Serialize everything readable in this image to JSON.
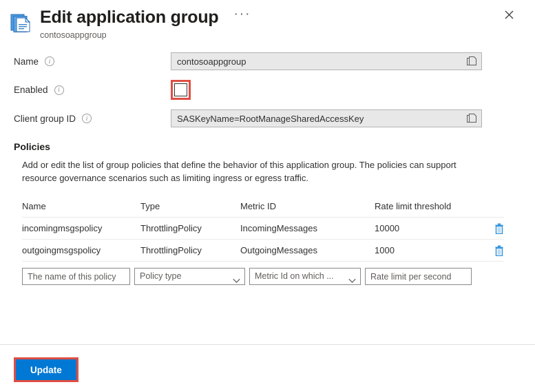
{
  "header": {
    "icon": "application-group-icon",
    "title": "Edit application group",
    "subtitle": "contosoappgroup",
    "ellipsis": "···",
    "close_label": "✕"
  },
  "form": {
    "rows": [
      {
        "label": "Name",
        "info": "i",
        "value": "contosoappgroup",
        "copy_icon": "copy-icon"
      },
      {
        "label": "Enabled",
        "info": "i",
        "checked": false
      },
      {
        "label": "Client group ID",
        "info": "i",
        "value": "SASKeyName=RootManageSharedAccessKey",
        "copy_icon": "copy-icon"
      }
    ]
  },
  "policies": {
    "title": "Policies",
    "description": "Add or edit the list of group policies that define the behavior of this application group. The policies can support resource governance scenarios such as limiting ingress or egress traffic.",
    "columns": [
      "Name",
      "Type",
      "Metric ID",
      "Rate limit threshold"
    ],
    "rows": [
      {
        "name": "incomingmsgspolicy",
        "type": "ThrottlingPolicy",
        "metric_id": "IncomingMessages",
        "rate_limit": "10000",
        "delete_icon": "trash-icon"
      },
      {
        "name": "outgoingmsgspolicy",
        "type": "ThrottlingPolicy",
        "metric_id": "OutgoingMessages",
        "rate_limit": "1000",
        "delete_icon": "trash-icon"
      }
    ],
    "new_row": {
      "name_placeholder": "The name of this policy",
      "name_value": "",
      "type_placeholder": "Policy type",
      "metric_placeholder": "Metric Id on which ...",
      "rate_placeholder": "Rate limit per second",
      "rate_value": ""
    }
  },
  "footer": {
    "update_label": "Update"
  },
  "colors": {
    "accent": "#0078d4",
    "highlight": "#e04e43",
    "icon_blue": "#3a96dd",
    "readonly_bg": "#e8e8e8",
    "border": "#8a8886"
  }
}
